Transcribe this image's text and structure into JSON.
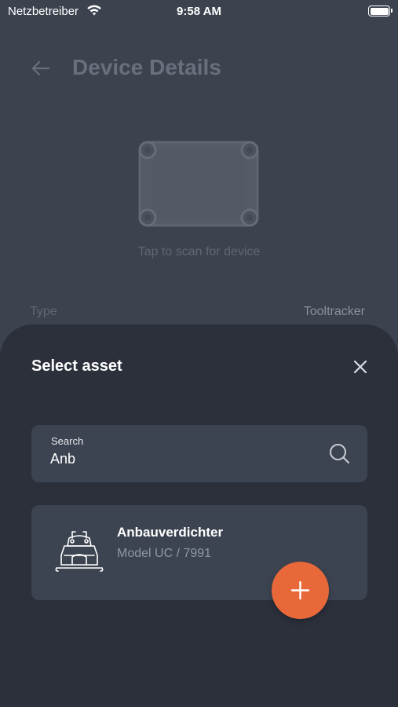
{
  "status_bar": {
    "carrier": "Netzbetreiber",
    "time": "9:58 AM"
  },
  "background": {
    "page_title": "Device Details",
    "scan_hint": "Tap to scan for device",
    "type_label": "Type",
    "type_value": "Tooltracker"
  },
  "sheet": {
    "title": "Select asset",
    "search": {
      "label": "Search",
      "value": "Anb"
    },
    "results": [
      {
        "name": "Anbauverdichter",
        "model": "Model UC / 7991",
        "icon": "compactor-icon"
      }
    ],
    "add_button_icon": "plus-icon"
  },
  "colors": {
    "background": "#3c434f",
    "sheet": "#2b303b",
    "card": "#3d4451",
    "accent": "#e8683a"
  }
}
